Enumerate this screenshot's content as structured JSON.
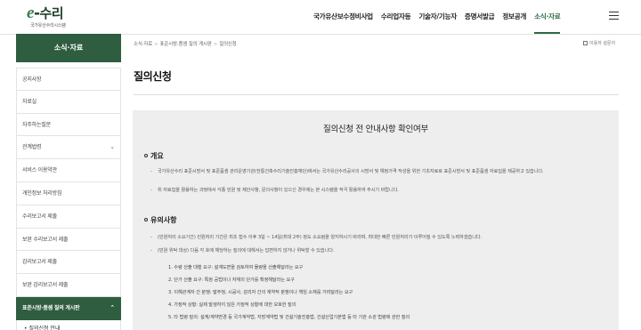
{
  "logo": {
    "main_prefix": "e",
    "main_suffix": "수리",
    "sub": "국가유산수리시스템"
  },
  "gnb": {
    "items": [
      "국가유산보수정비사업",
      "수리업자등",
      "기술자/기능자",
      "증명서발급",
      "정보공개",
      "소식·자료"
    ],
    "active_index": 5
  },
  "menu_icon": "hamburger-icon",
  "sidebar": {
    "title": "소식·자료",
    "items": [
      {
        "label": "공지사항"
      },
      {
        "label": "자료실"
      },
      {
        "label": "자주하는질문"
      },
      {
        "label": "관계법령",
        "chevron": "⌄"
      },
      {
        "label": "서비스 이용약관"
      },
      {
        "label": "개인정보 처리방침"
      },
      {
        "label": "수리보고서 제출"
      },
      {
        "label": "보완 수리보고서 제출"
      },
      {
        "label": "감리보고서 제출"
      },
      {
        "label": "보완 감리보고서 제출"
      },
      {
        "label": "표준시방·품셈 질의 게시판",
        "chevron": "⌃",
        "active": true
      }
    ],
    "sub_items": [
      "• 질의신청 안내"
    ]
  },
  "breadcrumb": [
    "소식·자료",
    "표준시방·품셈 질의 게시판",
    "질의신청"
  ],
  "util": {
    "label": "이용자 설문지",
    "icon": "survey-icon"
  },
  "page": {
    "title": "질의신청"
  },
  "panel": {
    "title": "질의신청 전 안내사항 확인여부",
    "sections": [
      {
        "heading": "개요",
        "paragraphs": [
          "국가유산수리 표준시방서 및 표준품셈 관리운영기관(전통건축수리기술진흥재단)에서는 국가유산수리공사의 시방서 및 예정가격 작성을 위한 기초자료로 표준시방서 및 표준품셈 자료집을 제공하고 있습니다.",
          "위 자료집을 활용하는 과정에서 각종 민원 및 제안사항, 문의사항이 있으신 경우에는 본 시스템을 적극 활용하여 주시기 바랍니다."
        ]
      },
      {
        "heading": "유의사항",
        "paragraphs": [
          "(민원처리 소요기간) 민원처리 기간은 최초 접수 이후 3일 ~ 14일(최대 2주) 정도 소요됨을 양지하시기 바라며, 최대한 빠른 민원처리가 이루어질 수 있도록 노력하겠습니다.",
          "(민원 위탁 대상) 다음 각 호에 해당하는 질의에 대해서는 답변하지 않거나 위탁할 수 있습니다."
        ],
        "numbered": [
          "1.  수량 산출 대행 요구: 설계도면을 검토하여 물량을 산출해달라는 요구",
          "2.  단가 산출 요구: 특정 공법이나 자재의 단가를 확정해달라는 요구",
          "3.  이해관계자 간 분쟁: 발주청, 시공사, 감리자 간의 계약적 분쟁이나 책임 소재를 가려달라는 요구",
          "4.  가정적 상황: 실제 발생하지 않은 가정적 상황에 대한 모호한 질의",
          "5.  타 법령 질의: 설계/계약변경 등 국가계약법, 지방계약법 및 건설기술진흥법, 건설산업기본법 등 타 기관 소관 법령에 관한 질의"
        ]
      }
    ]
  }
}
